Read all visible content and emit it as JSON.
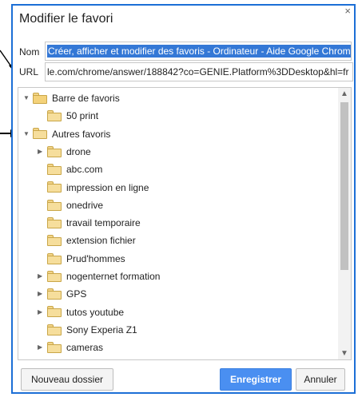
{
  "dialog": {
    "title": "Modifier le favori",
    "close": "×"
  },
  "fields": {
    "name_label": "Nom",
    "name_value": "Créer, afficher et modifier des favoris - Ordinateur - Aide Google Chrom",
    "url_label": "URL",
    "url_value": "le.com/chrome/answer/188842?co=GENIE.Platform%3DDesktop&hl=fr"
  },
  "tree": {
    "items": [
      {
        "label": "Barre de favoris",
        "level": 0,
        "expander": "down",
        "icon": "folder-open-icon"
      },
      {
        "label": "50 print",
        "level": 1,
        "expander": "none",
        "icon": "folder-icon"
      },
      {
        "label": "Autres favoris",
        "level": 0,
        "expander": "down",
        "icon": "folder-icon"
      },
      {
        "label": "drone",
        "level": 1,
        "expander": "right",
        "icon": "folder-icon"
      },
      {
        "label": "abc.com",
        "level": 1,
        "expander": "none",
        "icon": "folder-icon"
      },
      {
        "label": "impression en ligne",
        "level": 1,
        "expander": "none",
        "icon": "folder-icon"
      },
      {
        "label": "onedrive",
        "level": 1,
        "expander": "none",
        "icon": "folder-icon"
      },
      {
        "label": "travail temporaire",
        "level": 1,
        "expander": "none",
        "icon": "folder-icon"
      },
      {
        "label": "extension fichier",
        "level": 1,
        "expander": "none",
        "icon": "folder-icon"
      },
      {
        "label": "Prud'hommes",
        "level": 1,
        "expander": "none",
        "icon": "folder-icon"
      },
      {
        "label": "nogenternet formation",
        "level": 1,
        "expander": "right",
        "icon": "folder-icon"
      },
      {
        "label": "GPS",
        "level": 1,
        "expander": "right",
        "icon": "folder-icon"
      },
      {
        "label": "tutos youtube",
        "level": 1,
        "expander": "right",
        "icon": "folder-icon"
      },
      {
        "label": "Sony Experia Z1",
        "level": 1,
        "expander": "none",
        "icon": "folder-icon"
      },
      {
        "label": "cameras",
        "level": 1,
        "expander": "right",
        "icon": "folder-icon"
      }
    ]
  },
  "buttons": {
    "new_folder": "Nouveau dossier",
    "save": "Enregistrer",
    "cancel": "Annuler"
  },
  "colors": {
    "dialog_border": "#1c6fd6",
    "selection": "#3478d6",
    "primary_button": "#4a8ff1"
  }
}
